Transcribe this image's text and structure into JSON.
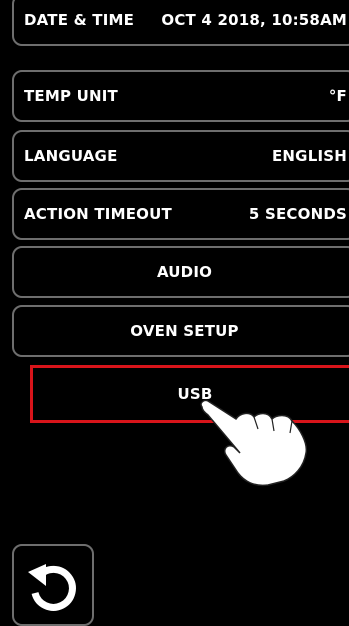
{
  "settings": {
    "date_time": {
      "label": "DATE & TIME",
      "value": "OCT 4 2018, 10:58AM"
    },
    "temp_unit": {
      "label": "TEMP UNIT",
      "value": "°F"
    },
    "language": {
      "label": "LANGUAGE",
      "value": "ENGLISH"
    },
    "action_timeout": {
      "label": "ACTION TIMEOUT",
      "value": "5 SECONDS"
    },
    "audio": {
      "label": "AUDIO"
    },
    "oven_setup": {
      "label": "OVEN SETUP"
    },
    "usb": {
      "label": "USB"
    }
  },
  "icons": {
    "back": "back-icon",
    "pointer": "hand-pointer-icon"
  },
  "colors": {
    "highlight": "#d8141a",
    "border": "#6e6e6e",
    "background": "#000000",
    "text": "#ffffff"
  }
}
